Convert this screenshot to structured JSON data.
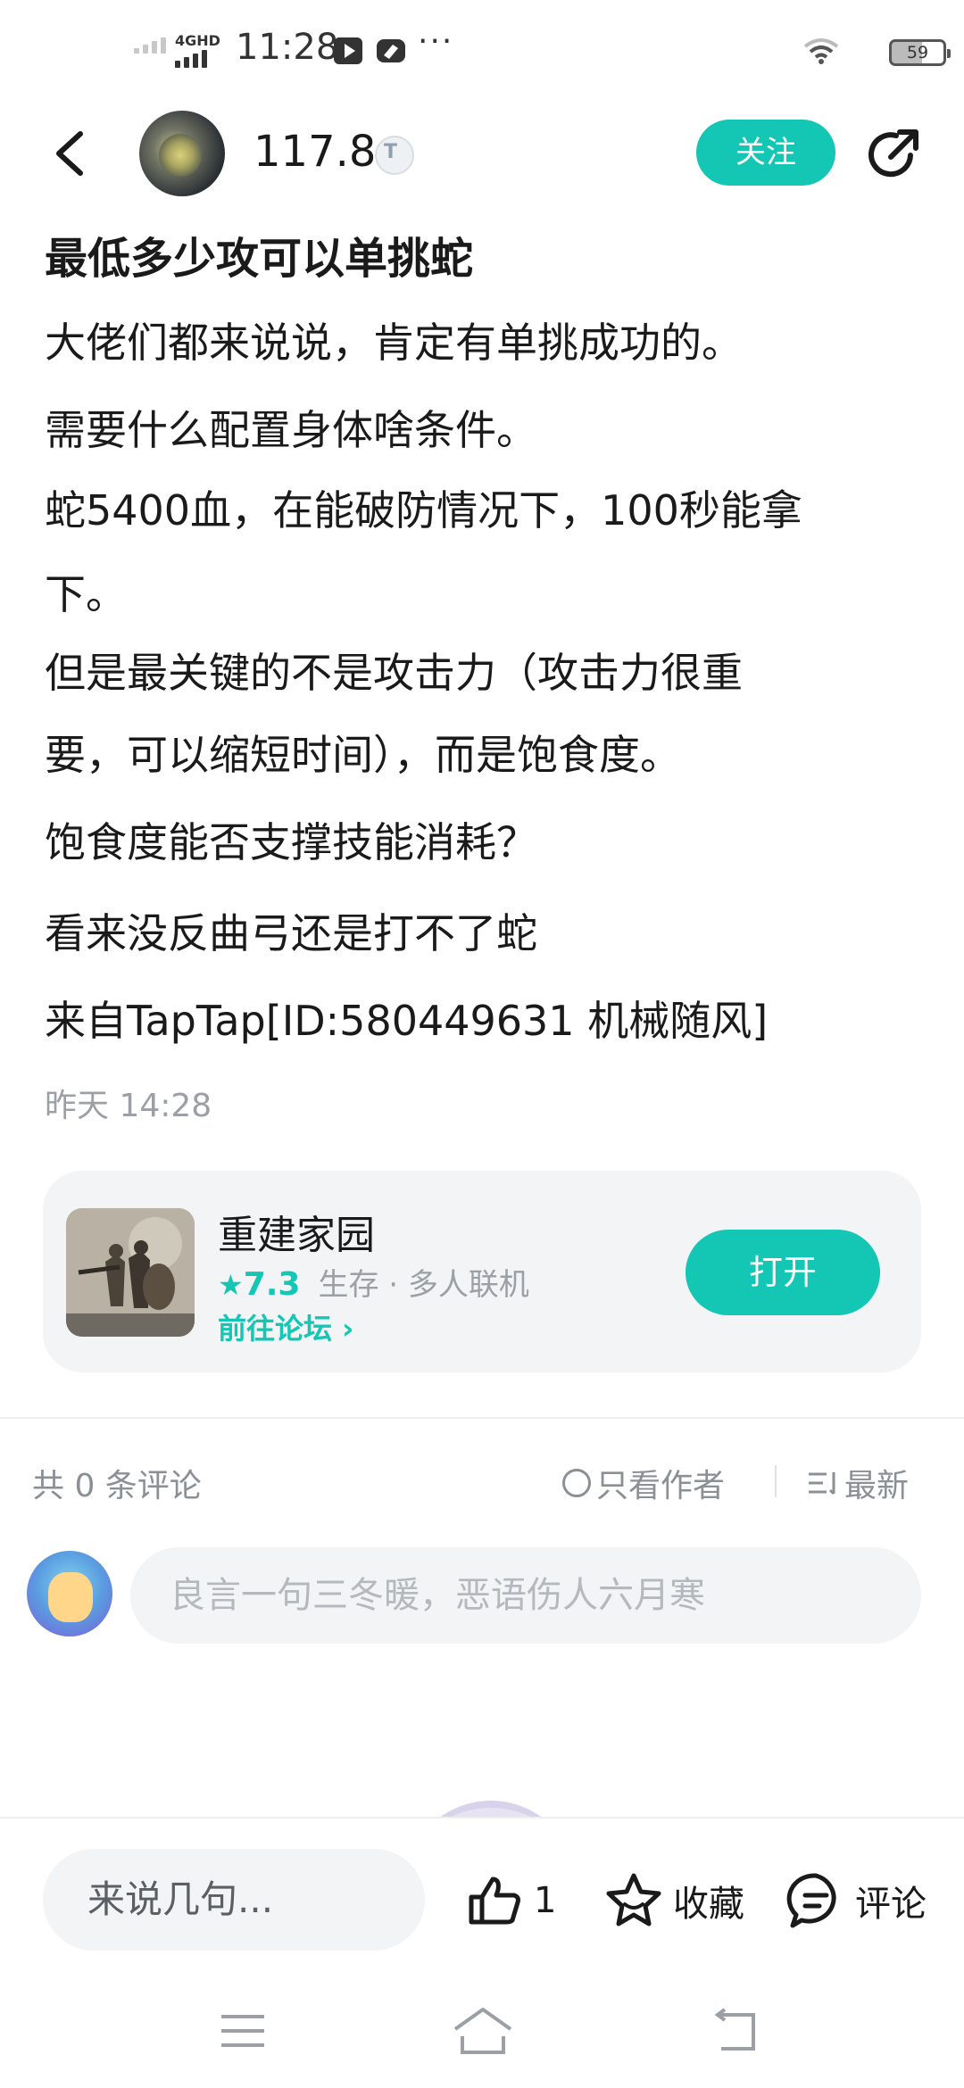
{
  "status_bar": {
    "network": "4GHD",
    "time": "11:28",
    "more": "···",
    "battery": "59"
  },
  "header": {
    "author_name": "117.8",
    "follow_label": "关注"
  },
  "post": {
    "title": "最低多少攻可以单挑蛇",
    "lines": [
      "大佬们都来说说，肯定有单挑成功的。",
      "需要什么配置身体啥条件。",
      "蛇5400血，在能破防情况下，100秒能拿",
      "下。",
      "但是最关键的不是攻击力（攻击力很重",
      "要，可以缩短时间），而是饱食度。",
      "饱食度能否支撑技能消耗？",
      "看来没反曲弓还是打不了蛇",
      "来自TapTap[ID:580449631 机械随风]"
    ],
    "time": "昨天 14:28"
  },
  "game_card": {
    "name": "重建家园",
    "star": "★",
    "rating": "7.3",
    "tags": "生存 · 多人联机",
    "forum_link": "前往论坛 ›",
    "open_label": "打开"
  },
  "comments": {
    "count_label": "共 0 条评论",
    "author_only_label": "只看作者",
    "sort_label": "最新",
    "input_placeholder": "良言一句三冬暖，恶语伤人六月寒"
  },
  "bottom_bar": {
    "say_placeholder": "来说几句...",
    "like_count": "1",
    "favorite_label": "收藏",
    "comment_label": "评论"
  },
  "colors": {
    "accent": "#14c6b4",
    "muted": "#9aa0a6",
    "input_bg": "#f2f4f6"
  }
}
